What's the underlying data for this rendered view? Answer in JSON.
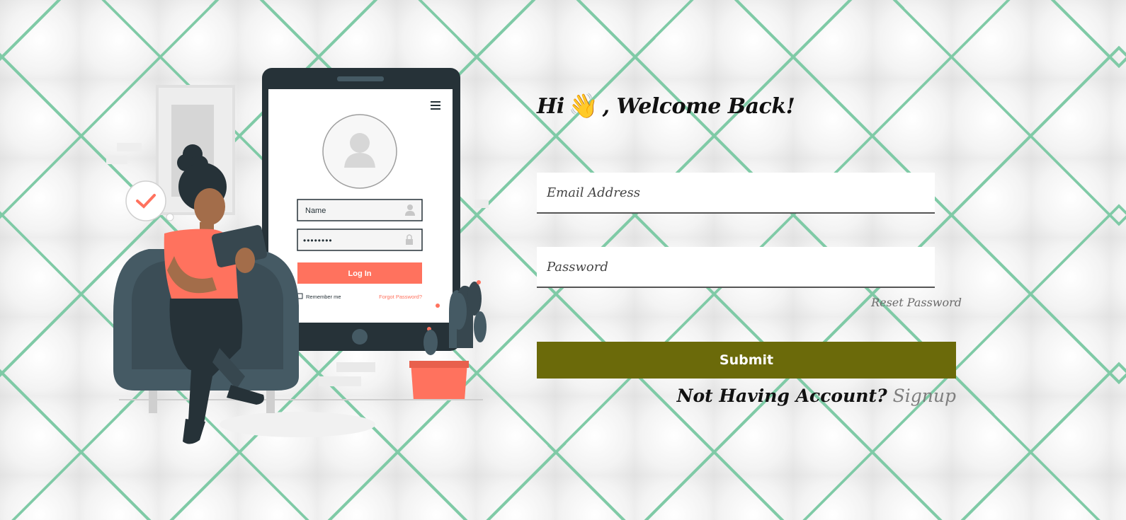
{
  "illustration": {
    "name_placeholder": "Name",
    "password_dots": "••••••••",
    "login_button": "Log In",
    "remember_me": "Remember me",
    "forgot_password": "Forgot Password?"
  },
  "login": {
    "greeting_prefix": "Hi",
    "greeting_emoji": "👋",
    "greeting_suffix": ", Welcome Back!",
    "email_placeholder": "Email Address",
    "password_placeholder": "Password",
    "reset_password": "Reset Password",
    "submit_label": "Submit",
    "signup_question": "Not Having Account?",
    "signup_link": "Signup"
  },
  "colors": {
    "submit_bg": "#6b6a0a",
    "accent_coral": "#ff725e",
    "device_dark": "#263238",
    "grid_green": "#7fcaa6"
  }
}
